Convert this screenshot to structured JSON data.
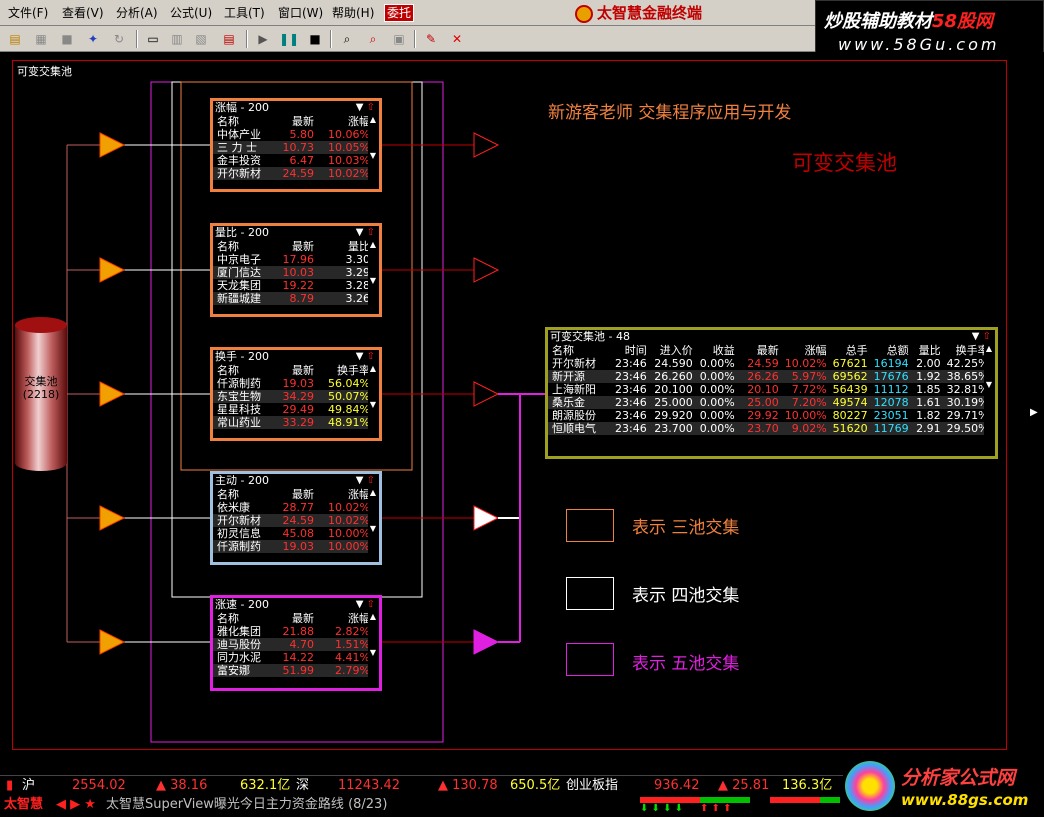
{
  "menu": {
    "items": [
      "文件(F)",
      "查看(V)",
      "分析(A)",
      "公式(U)",
      "工具(T)",
      "窗口(W)",
      "帮助(H)"
    ],
    "entrust": "委托",
    "app_title": "太智慧金融终端"
  },
  "watermark_top": {
    "line1a": "炒股辅助教材",
    "line1b": "58股网",
    "line2": "www.58Gu.com"
  },
  "canvas": {
    "title": "可变交集池",
    "heading": "新游客老师 交集程序应用与开发",
    "subheading": "可变交集池",
    "cylinder_label": "交集池",
    "cylinder_count": "(2218)"
  },
  "pools": [
    {
      "title": "涨幅 - 200",
      "headers": [
        "名称",
        "最新",
        "涨幅"
      ],
      "rows": [
        [
          "中体产业",
          "5.80",
          "10.06%"
        ],
        [
          "三 力 士",
          "10.73",
          "10.05%"
        ],
        [
          "金丰投资",
          "6.47",
          "10.03%"
        ],
        [
          "开尔新材",
          "24.59",
          "10.02%"
        ]
      ]
    },
    {
      "title": "量比 - 200",
      "headers": [
        "名称",
        "最新",
        "量比"
      ],
      "rows": [
        [
          "中京电子",
          "17.96",
          "3.30"
        ],
        [
          "厦门信达",
          "10.03",
          "3.29"
        ],
        [
          "天龙集团",
          "19.22",
          "3.28"
        ],
        [
          "新疆城建",
          "8.79",
          "3.26"
        ]
      ]
    },
    {
      "title": "换手 - 200",
      "headers": [
        "名称",
        "最新",
        "换手率"
      ],
      "rows": [
        [
          "仟源制药",
          "19.03",
          "56.04%"
        ],
        [
          "东宝生物",
          "34.29",
          "50.07%"
        ],
        [
          "星星科技",
          "29.49",
          "49.84%"
        ],
        [
          "常山药业",
          "33.29",
          "48.91%"
        ]
      ]
    },
    {
      "title": "主动 - 200",
      "headers": [
        "名称",
        "最新",
        "涨幅"
      ],
      "rows": [
        [
          "依米康",
          "28.77",
          "10.02%"
        ],
        [
          "开尔新材",
          "24.59",
          "10.02%"
        ],
        [
          "初灵信息",
          "45.08",
          "10.00%"
        ],
        [
          "仟源制药",
          "19.03",
          "10.00%"
        ]
      ]
    },
    {
      "title": "涨速 - 200",
      "headers": [
        "名称",
        "最新",
        "涨幅"
      ],
      "rows": [
        [
          "雅化集团",
          "21.88",
          "2.82%"
        ],
        [
          "迪马股份",
          "4.70",
          "1.51%"
        ],
        [
          "同力水泥",
          "14.22",
          "4.41%"
        ],
        [
          "富安娜",
          "51.99",
          "2.79%"
        ]
      ]
    }
  ],
  "result_pool": {
    "title": "可变交集池 - 48",
    "headers": [
      "名称",
      "时间",
      "进入价",
      "收益",
      "最新",
      "涨幅",
      "总手",
      "总额",
      "量比",
      "换手率"
    ],
    "rows": [
      [
        "开尔新材",
        "23:46",
        "24.590",
        "0.00%",
        "24.59",
        "10.02%",
        "67621",
        "16194",
        "2.00",
        "42.25%"
      ],
      [
        "新开源",
        "23:46",
        "26.260",
        "0.00%",
        "26.26",
        "5.97%",
        "69562",
        "17676",
        "1.92",
        "38.65%"
      ],
      [
        "上海新阳",
        "23:46",
        "20.100",
        "0.00%",
        "20.10",
        "7.72%",
        "56439",
        "11112",
        "1.85",
        "32.81%"
      ],
      [
        "桑乐金",
        "23:46",
        "25.000",
        "0.00%",
        "25.00",
        "7.20%",
        "49574",
        "12078",
        "1.61",
        "30.19%"
      ],
      [
        "朗源股份",
        "23:46",
        "29.920",
        "0.00%",
        "29.92",
        "10.00%",
        "80227",
        "23051",
        "1.82",
        "29.71%"
      ],
      [
        "恒顺电气",
        "23:46",
        "23.700",
        "0.00%",
        "23.70",
        "9.02%",
        "51620",
        "11769",
        "2.91",
        "29.50%"
      ]
    ]
  },
  "legend": [
    {
      "label": "表示 三池交集",
      "color": "#f08040"
    },
    {
      "label": "表示 四池交集",
      "color": "#ffffff"
    },
    {
      "label": "表示 五池交集",
      "color": "#e020e0"
    }
  ],
  "status": {
    "sh_label": "沪",
    "sh_index": "2554.02",
    "sh_change": "▲ 38.16",
    "sh_amount": "632.1亿",
    "sz_label": "深",
    "sz_index": "11243.42",
    "sz_change": "▲ 130.78",
    "sz_amount": "650.5亿",
    "cy_label": "创业板指",
    "cy_index": "936.42",
    "cy_change": "▲ 25.81",
    "cy_amount": "136.3亿"
  },
  "ticker": {
    "brand": "太智慧",
    "nav": "◀ ▶ ★",
    "message": "太智慧SuperView曝光今日主力资金路线 (8/23)"
  },
  "watermark_bottom": {
    "line1": "分析家公式网",
    "line2": "www.88gs.com"
  }
}
